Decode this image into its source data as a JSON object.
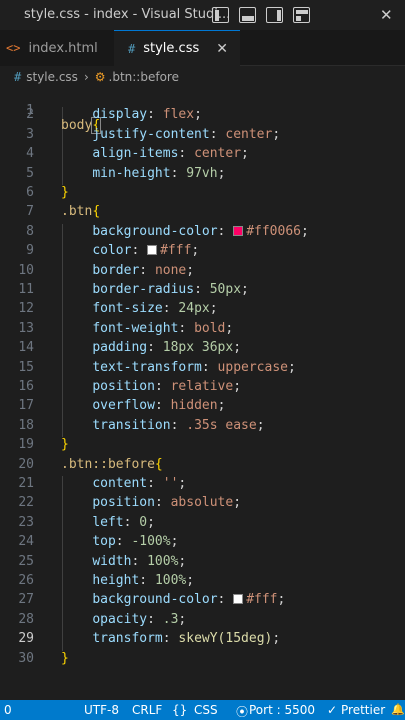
{
  "titlebar": {
    "title": "style.css - index - Visual Studi...",
    "close_symbol": "✕"
  },
  "tabs": [
    {
      "icon": "<>",
      "label": "index.html"
    },
    {
      "icon": "#",
      "label": "style.css",
      "close": "✕"
    }
  ],
  "breadcrumb": {
    "file": "style.css",
    "symbol": ".btn::before"
  },
  "editor": {
    "line_numbers": [
      "1",
      "2",
      "3",
      "4",
      "5",
      "6",
      "7",
      "8",
      "9",
      "10",
      "11",
      "12",
      "13",
      "14",
      "15",
      "16",
      "17",
      "18",
      "19",
      "20",
      "21",
      "22",
      "23",
      "24",
      "25",
      "26",
      "27",
      "28",
      "29",
      "30"
    ],
    "active_line": "29",
    "rules": [
      {
        "selector": "body",
        "brace_open": "{",
        "brace_close": "}",
        "decls": [
          {
            "prop": "display",
            "value": "flex"
          },
          {
            "prop": "justify-content",
            "value": "center"
          },
          {
            "prop": "align-items",
            "value": "center"
          },
          {
            "prop": "min-height",
            "value": "97vh"
          }
        ]
      },
      {
        "selector": ".btn",
        "brace_open": "{",
        "brace_close": "}",
        "decls": [
          {
            "prop": "background-color",
            "value": "#ff0066",
            "swatch": "#ff0066"
          },
          {
            "prop": "color",
            "value": "#fff",
            "swatch": "#ffffff"
          },
          {
            "prop": "border",
            "value": "none"
          },
          {
            "prop": "border-radius",
            "value": "50px"
          },
          {
            "prop": "font-size",
            "value": "24px"
          },
          {
            "prop": "font-weight",
            "value": "bold"
          },
          {
            "prop": "padding",
            "value": "18px 36px"
          },
          {
            "prop": "text-transform",
            "value": "uppercase"
          },
          {
            "prop": "position",
            "value": "relative"
          },
          {
            "prop": "overflow",
            "value": "hidden"
          },
          {
            "prop": "transition",
            "value": ".35s ease"
          }
        ]
      },
      {
        "selector": ".btn::before",
        "brace_open": "{",
        "brace_close": "}",
        "decls": [
          {
            "prop": "content",
            "value": "''"
          },
          {
            "prop": "position",
            "value": "absolute"
          },
          {
            "prop": "left",
            "value": "0"
          },
          {
            "prop": "top",
            "value": "-100%"
          },
          {
            "prop": "width",
            "value": "100%"
          },
          {
            "prop": "height",
            "value": "100%"
          },
          {
            "prop": "background-color",
            "value": "#fff",
            "swatch": "#ffffff"
          },
          {
            "prop": "opacity",
            "value": ".3"
          },
          {
            "prop": "transform",
            "value": "skewY(15deg)"
          }
        ]
      }
    ]
  },
  "statusbar": {
    "errors": "0",
    "encoding": "UTF-8",
    "eol": "CRLF",
    "braces": "{}",
    "language": "CSS",
    "port": "Port : 5500",
    "prettier": "Prettier",
    "bell": "🔔",
    "accent": "#007acc"
  }
}
